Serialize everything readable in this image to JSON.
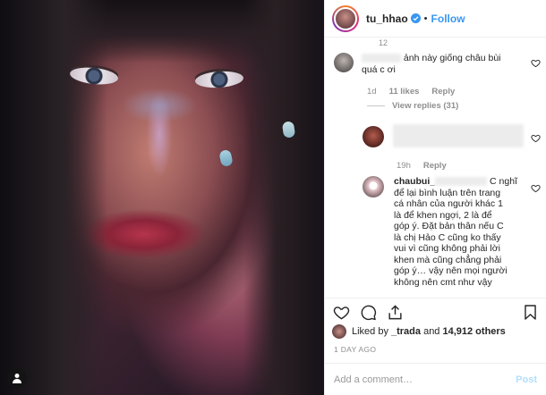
{
  "post": {
    "username": "tu_hhao",
    "separator": "•",
    "follow_label": "Follow"
  },
  "comments": {
    "cut_number": "12",
    "first": {
      "text_tail_1": "ảnh này giống châu bùi",
      "text_tail_2": "quá c ơi",
      "age": "1d",
      "likes": "11 likes",
      "reply_label": "Reply",
      "view_replies": "View replies (31)"
    },
    "second": {
      "age": "19h",
      "reply_label": "Reply"
    },
    "third": {
      "username": "chaubui_",
      "text_after_blur": "C nghĩ",
      "lines": [
        "để lại bình luận trên trang",
        "cá nhân của người khác 1",
        "là để khen ngợi, 2 là để",
        "góp ý. Đặt bản thân nếu C",
        "là chị Hảo C cũng ko thấy",
        "vui vì cũng không phải lời",
        "khen mà cũng chẳng phải",
        "góp ý… vậy nên mọi người",
        "không nên cmt như vậy"
      ]
    }
  },
  "likes": {
    "prefix": "Liked by ",
    "user": "_trada",
    "middle": " and ",
    "count": "14,912 others"
  },
  "time_ago": "1 DAY AGO",
  "add_comment": {
    "placeholder": "Add a comment…",
    "post_label": "Post"
  },
  "colors": {
    "accent": "#3897f0",
    "post_disabled": "#b2dffc",
    "muted": "#8e8e8e"
  },
  "icons": [
    "heart-icon",
    "comment-icon",
    "share-icon",
    "bookmark-icon",
    "verified-icon",
    "user-tag-icon"
  ]
}
